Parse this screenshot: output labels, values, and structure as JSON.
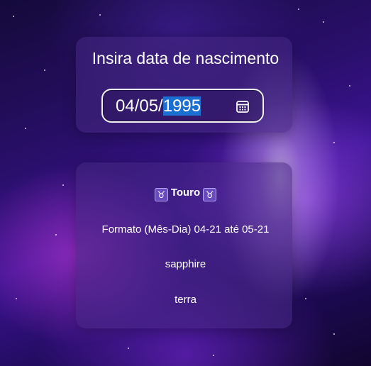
{
  "input_card": {
    "title": "Insira data de nascimento",
    "date_prefix": "04/05/",
    "date_selected": "1995",
    "calendar_icon": "calendar-icon"
  },
  "result": {
    "sign_symbol": "♉",
    "sign_name": "Touro",
    "format_text": "Formato (Mês-Dia) 04-21 até 05-21",
    "stone": "sapphire",
    "element": "terra"
  },
  "colors": {
    "selection": "#1a6fd1",
    "card": "#46288299",
    "input_border": "#f2f2f2",
    "background_accent": "#3b1392"
  }
}
